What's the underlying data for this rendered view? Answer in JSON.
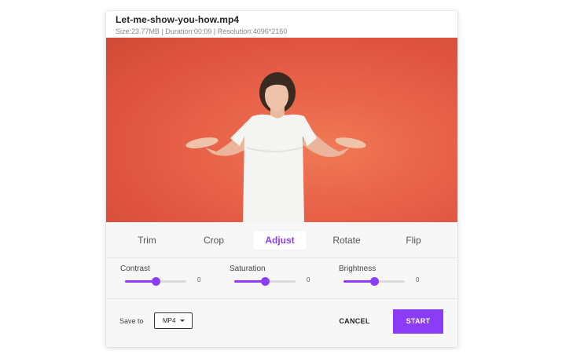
{
  "video": {
    "file_name": "Let-me-show-you-how.mp4",
    "meta": "Size:23.77MB | Duration:00:09 | Resolution:4096*2160"
  },
  "tabs": [
    {
      "label": "Trim",
      "active": false
    },
    {
      "label": "Crop",
      "active": false
    },
    {
      "label": "Adjust",
      "active": true
    },
    {
      "label": "Rotate",
      "active": false
    },
    {
      "label": "Flip",
      "active": false
    }
  ],
  "sliders": [
    {
      "label": "Contrast",
      "value": "0",
      "level": 0.5
    },
    {
      "label": "Saturation",
      "value": "0",
      "level": 0.5
    },
    {
      "label": "Brightness",
      "value": "0",
      "level": 0.5
    }
  ],
  "footer": {
    "save_label": "Save to",
    "format": "MP4",
    "cancel_label": "CANCEL",
    "start_label": "START"
  },
  "colors": {
    "accent": "#8b3cf7",
    "video_background": "#e35a44"
  }
}
